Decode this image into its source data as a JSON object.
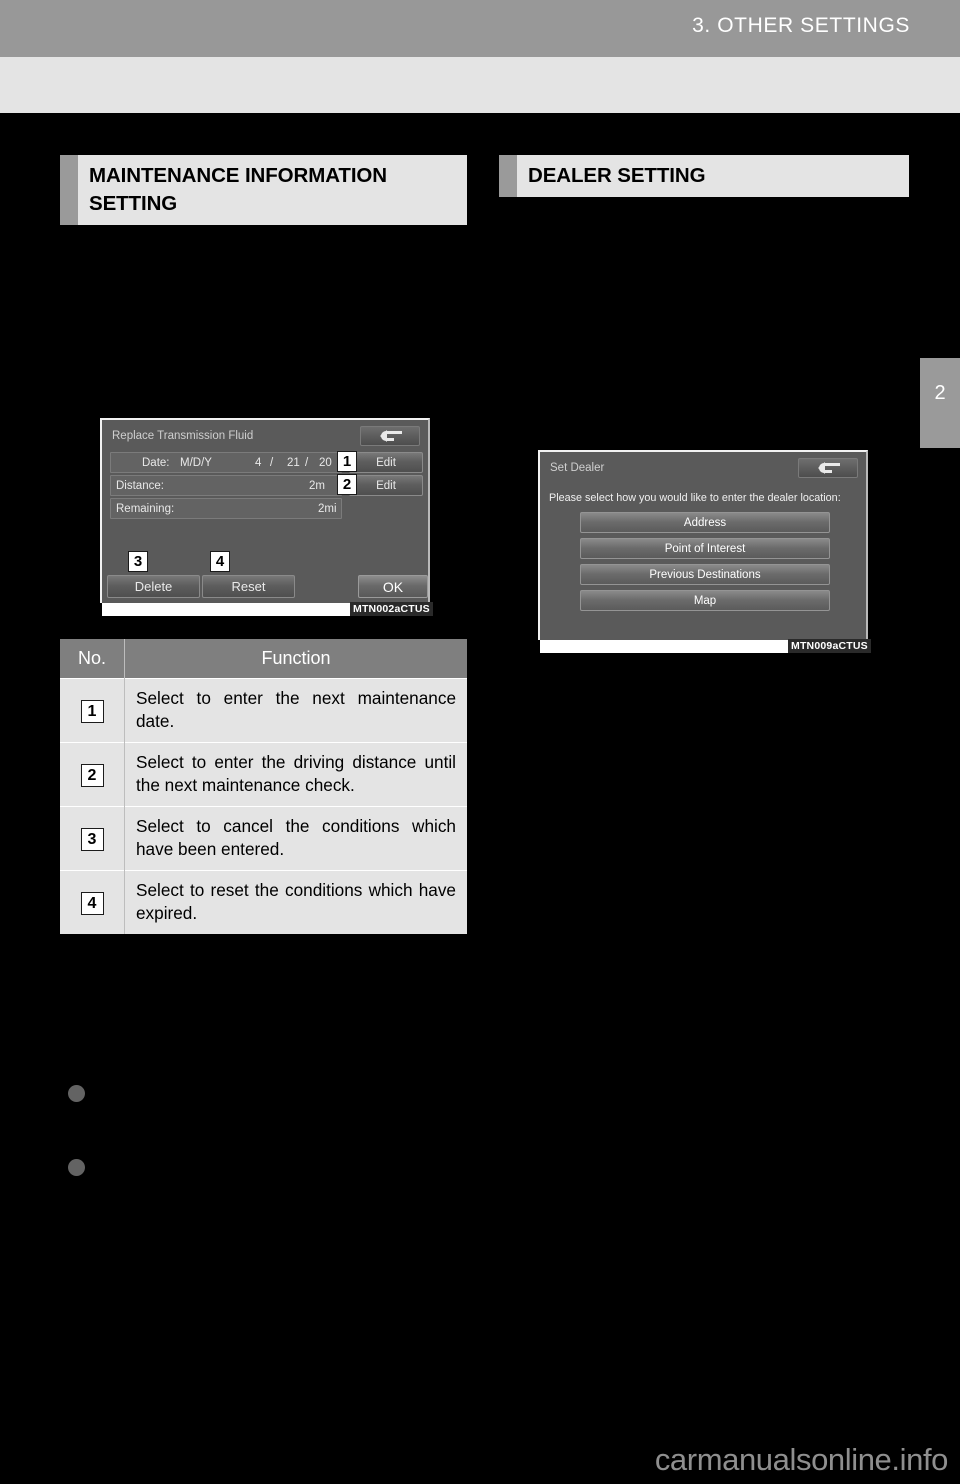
{
  "page": {
    "header_title": "3. OTHER SETTINGS",
    "chapter_tab": "2",
    "watermark": "carmanualsonline.info"
  },
  "sections": {
    "maintenance": {
      "title": "MAINTENANCE INFORMATION SETTING"
    },
    "dealer": {
      "title": "DEALER SETTING"
    }
  },
  "figure_maintenance": {
    "code": "MTN002aCTUS",
    "screen_title": "Replace Transmission Fluid",
    "back_icon": "back-arrow-icon",
    "rows": [
      {
        "label": "Date:",
        "format": "M/D/Y",
        "month": "4",
        "sep1": "/",
        "day": "21",
        "sep2": "/",
        "year": "20",
        "edit_label": "Edit"
      },
      {
        "label": "Distance:",
        "value": "2m",
        "edit_label": "Edit"
      },
      {
        "label": "Remaining:",
        "value": "2mi"
      }
    ],
    "buttons": {
      "delete": "Delete",
      "reset": "Reset",
      "ok": "OK"
    },
    "callouts": [
      "1",
      "2",
      "3",
      "4"
    ]
  },
  "figure_dealer": {
    "code": "MTN009aCTUS",
    "screen_title": "Set Dealer",
    "back_icon": "back-arrow-icon",
    "prompt": "Please select how you would like to enter the dealer location:",
    "options": [
      "Address",
      "Point of Interest",
      "Previous Destinations",
      "Map"
    ]
  },
  "function_table": {
    "headers": {
      "no": "No.",
      "function": "Function"
    },
    "rows": [
      {
        "no": "1",
        "text": "Select to enter the next maintenance date."
      },
      {
        "no": "2",
        "text": "Select to enter the driving distance until the next maintenance check."
      },
      {
        "no": "3",
        "text": "Select to cancel the conditions which have been entered."
      },
      {
        "no": "4",
        "text": "Select to reset the conditions which have expired."
      }
    ]
  }
}
